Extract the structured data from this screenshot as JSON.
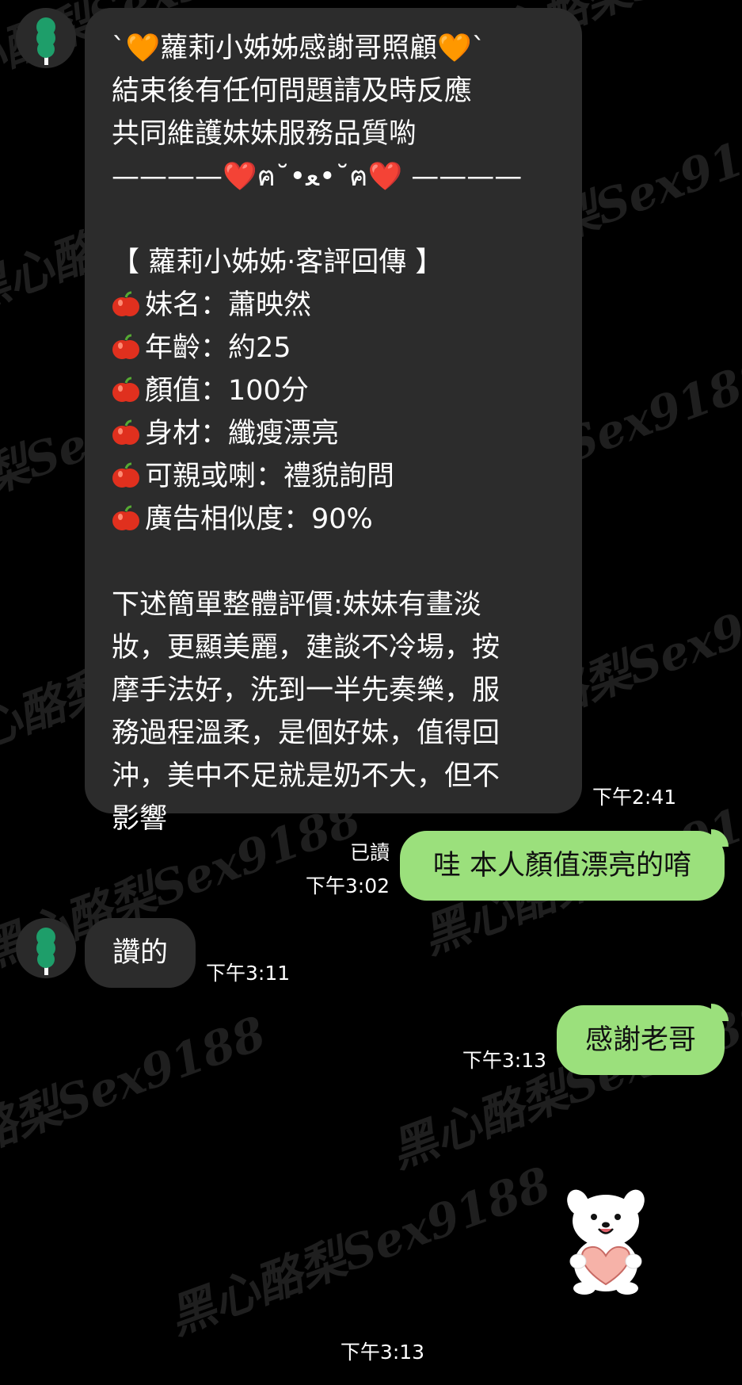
{
  "messages": {
    "m1": {
      "lines": [
        "`🧡蘿莉小姊姊感謝哥照顧🧡`",
        "結束後有任何問題請及時反應",
        "共同維護妹妹服務品質喲",
        " ————❤️ฅ˘•ﻌ•˘ฅ❤️ ————",
        "",
        "【 蘿莉小姊姊·客評回傳 】"
      ],
      "fields": [
        {
          "label": "妹名：",
          "value": "蕭映然"
        },
        {
          "label": "年齡：",
          "value": "約25"
        },
        {
          "label": "顏值：",
          "value": "100分"
        },
        {
          "label": "身材：",
          "value": "纖瘦漂亮"
        },
        {
          "label": "可親或喇：",
          "value": "禮貌詢問"
        },
        {
          "label": "廣告相似度：",
          "value": "90%"
        }
      ],
      "review": [
        "下述簡單整體評價:妹妹有畫淡",
        "妝，更顯美麗，建談不冷場，按",
        "摩手法好，洗到一半先奏樂，服",
        "務過程溫柔，是個好妹，值得回",
        "沖，美中不足就是奶不大，但不",
        "影響"
      ],
      "time": "下午2:41"
    },
    "m2": {
      "text": "哇 本人顏值漂亮的唷",
      "read": "已讀",
      "time": "下午3:02"
    },
    "m3": {
      "text": "讚的",
      "time": "下午3:11"
    },
    "m4": {
      "text": "感謝老哥",
      "time": "下午3:13"
    },
    "m5": {
      "sticker": "bear-holding-heart",
      "time": "下午3:13"
    }
  },
  "watermark": "黑心酪梨Sex9188",
  "colors": {
    "incoming_bubble": "#2c2c2c",
    "outgoing_bubble": "#9be07c",
    "avatar_green": "#1e9e6a"
  },
  "icons": {
    "list_bullet": "red-apple-icon",
    "avatar": "green-dango-avatar-icon"
  }
}
